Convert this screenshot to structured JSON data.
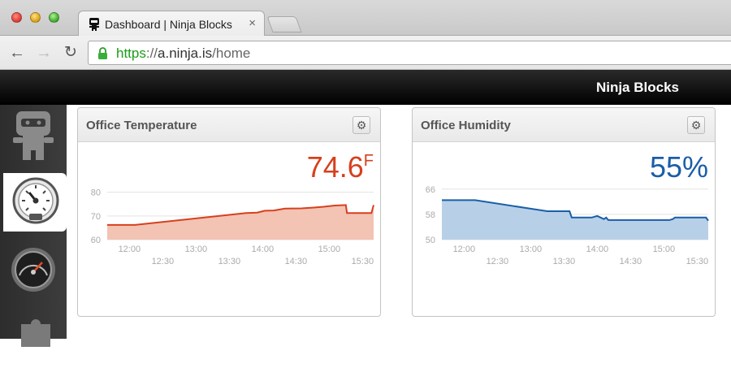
{
  "browser": {
    "tab_title": "Dashboard | Ninja Blocks",
    "tab_close": "×",
    "url": {
      "scheme": "https",
      "separator": "://",
      "host": "a.ninja.is",
      "path": "/home"
    }
  },
  "app": {
    "brand": "Ninja Blocks",
    "sidebar": [
      {
        "name": "ninja-logo-icon"
      },
      {
        "name": "gauge-icon",
        "active": true
      },
      {
        "name": "speedometer-icon"
      },
      {
        "name": "puzzle-icon"
      }
    ]
  },
  "widgets": [
    {
      "title": "Office Temperature",
      "reading": "74.6",
      "unit": "F",
      "color": "#d6401c",
      "fill": "#f3c3b4",
      "chart_data": {
        "type": "area",
        "ylim": [
          60,
          84
        ],
        "y_ticks": [
          "80",
          "70",
          "60"
        ],
        "x_ticks_upper": [
          "12:00",
          "13:00",
          "14:00",
          "15:00"
        ],
        "x_ticks_lower": [
          "12:30",
          "13:30",
          "14:30",
          "15:30"
        ],
        "x_range": [
          "11:40",
          "15:40"
        ],
        "points": [
          [
            "11:40",
            66.2
          ],
          [
            "12:05",
            66.2
          ],
          [
            "13:45",
            71.2
          ],
          [
            "13:55",
            71.4
          ],
          [
            "14:02",
            72.2
          ],
          [
            "14:10",
            72.3
          ],
          [
            "14:20",
            73.1
          ],
          [
            "14:35",
            73.2
          ],
          [
            "14:45",
            73.5
          ],
          [
            "14:55",
            73.9
          ],
          [
            "15:05",
            74.4
          ],
          [
            "15:15",
            74.6
          ],
          [
            "15:16",
            71.2
          ],
          [
            "15:38",
            71.2
          ],
          [
            "15:40",
            74.6
          ]
        ]
      }
    },
    {
      "title": "Office Humidity",
      "reading": "55%",
      "color": "#1a5ea8",
      "fill": "#b8d0e7",
      "chart_data": {
        "type": "area",
        "ylim": [
          50,
          68
        ],
        "y_ticks": [
          "66",
          "58",
          "50"
        ],
        "x_ticks_upper": [
          "12:00",
          "13:00",
          "14:00",
          "15:00"
        ],
        "x_ticks_lower": [
          "12:30",
          "13:30",
          "14:30",
          "15:30"
        ],
        "x_range": [
          "11:40",
          "15:40"
        ],
        "points": [
          [
            "11:40",
            62.5
          ],
          [
            "12:10",
            62.5
          ],
          [
            "13:15",
            59.0
          ],
          [
            "13:35",
            59.0
          ],
          [
            "13:37",
            57.0
          ],
          [
            "13:55",
            57.0
          ],
          [
            "14:00",
            57.5
          ],
          [
            "14:06",
            56.5
          ],
          [
            "14:08",
            57.0
          ],
          [
            "14:10",
            56.2
          ],
          [
            "15:05",
            56.2
          ],
          [
            "15:08",
            56.5
          ],
          [
            "15:10",
            57.0
          ],
          [
            "15:38",
            57.0
          ],
          [
            "15:40",
            56.0
          ]
        ]
      }
    }
  ]
}
